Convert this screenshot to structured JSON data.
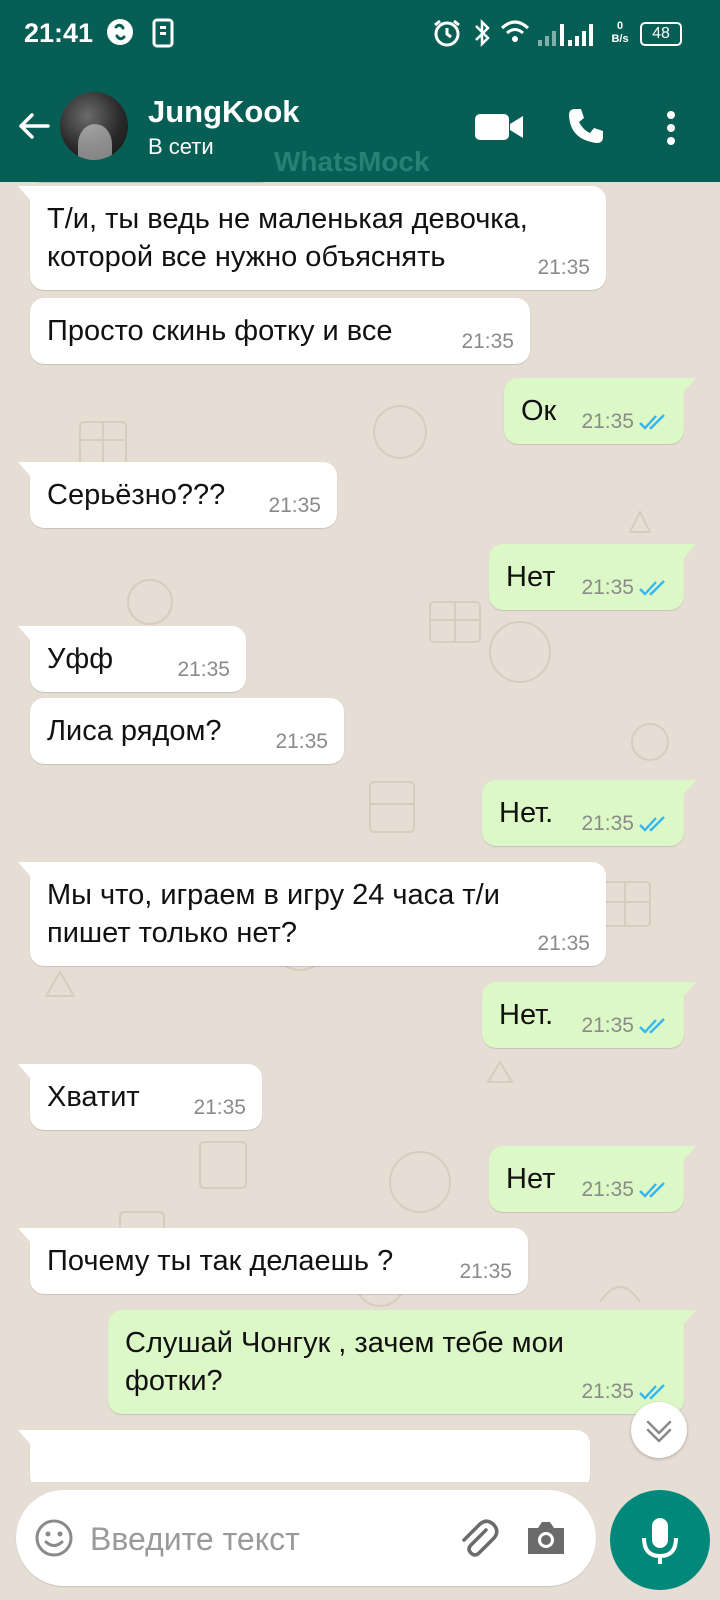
{
  "status_bar": {
    "time": "21:41",
    "net_speed_value": "0",
    "net_speed_unit": "B/s",
    "battery": "48"
  },
  "header": {
    "contact_name": "JungKook",
    "presence": "В сети",
    "watermark": "WhatsMock",
    "icons": [
      "back-arrow-icon",
      "avatar",
      "video-call-icon",
      "phone-icon",
      "more-vert-icon"
    ]
  },
  "messages": [
    {
      "dir": "in",
      "text": "Т/и, ты ведь не маленькая девочка, которой все нужно объяснять",
      "time": "21:35"
    },
    {
      "dir": "in",
      "text": "Просто скинь фотку и все",
      "time": "21:35"
    },
    {
      "dir": "out",
      "text": "Ок",
      "time": "21:35",
      "read": true
    },
    {
      "dir": "in",
      "text": "Серьёзно???",
      "time": "21:35"
    },
    {
      "dir": "out",
      "text": "Нет",
      "time": "21:35",
      "read": true
    },
    {
      "dir": "in",
      "text": "Уфф",
      "time": "21:35"
    },
    {
      "dir": "in",
      "text": "Лиса рядом?",
      "time": "21:35"
    },
    {
      "dir": "out",
      "text": "Нет.",
      "time": "21:35",
      "read": true
    },
    {
      "dir": "in",
      "text": "Мы что, играем в игру 24 часа т/и пишет только нет?",
      "time": "21:35"
    },
    {
      "dir": "out",
      "text": "Нет.",
      "time": "21:35",
      "read": true
    },
    {
      "dir": "in",
      "text": "Хватит",
      "time": "21:35"
    },
    {
      "dir": "out",
      "text": "Нет",
      "time": "21:35",
      "read": true
    },
    {
      "dir": "in",
      "text": "Почему ты так делаешь ?",
      "time": "21:35"
    },
    {
      "dir": "out",
      "text": "Слушай Чонгук , зачем тебе мои фотки?",
      "time": "21:35",
      "read": true
    }
  ],
  "composer": {
    "placeholder": "Введите текст",
    "icons": [
      "emoji-icon",
      "attach-icon",
      "camera-icon",
      "mic-icon"
    ]
  },
  "colors": {
    "header": "#075e54",
    "outgoing_bubble": "#dcf8c6",
    "incoming_bubble": "#ffffff",
    "chat_bg": "#e6ddd4",
    "read_ticks": "#34b7f1",
    "mic_button": "#00897b"
  }
}
